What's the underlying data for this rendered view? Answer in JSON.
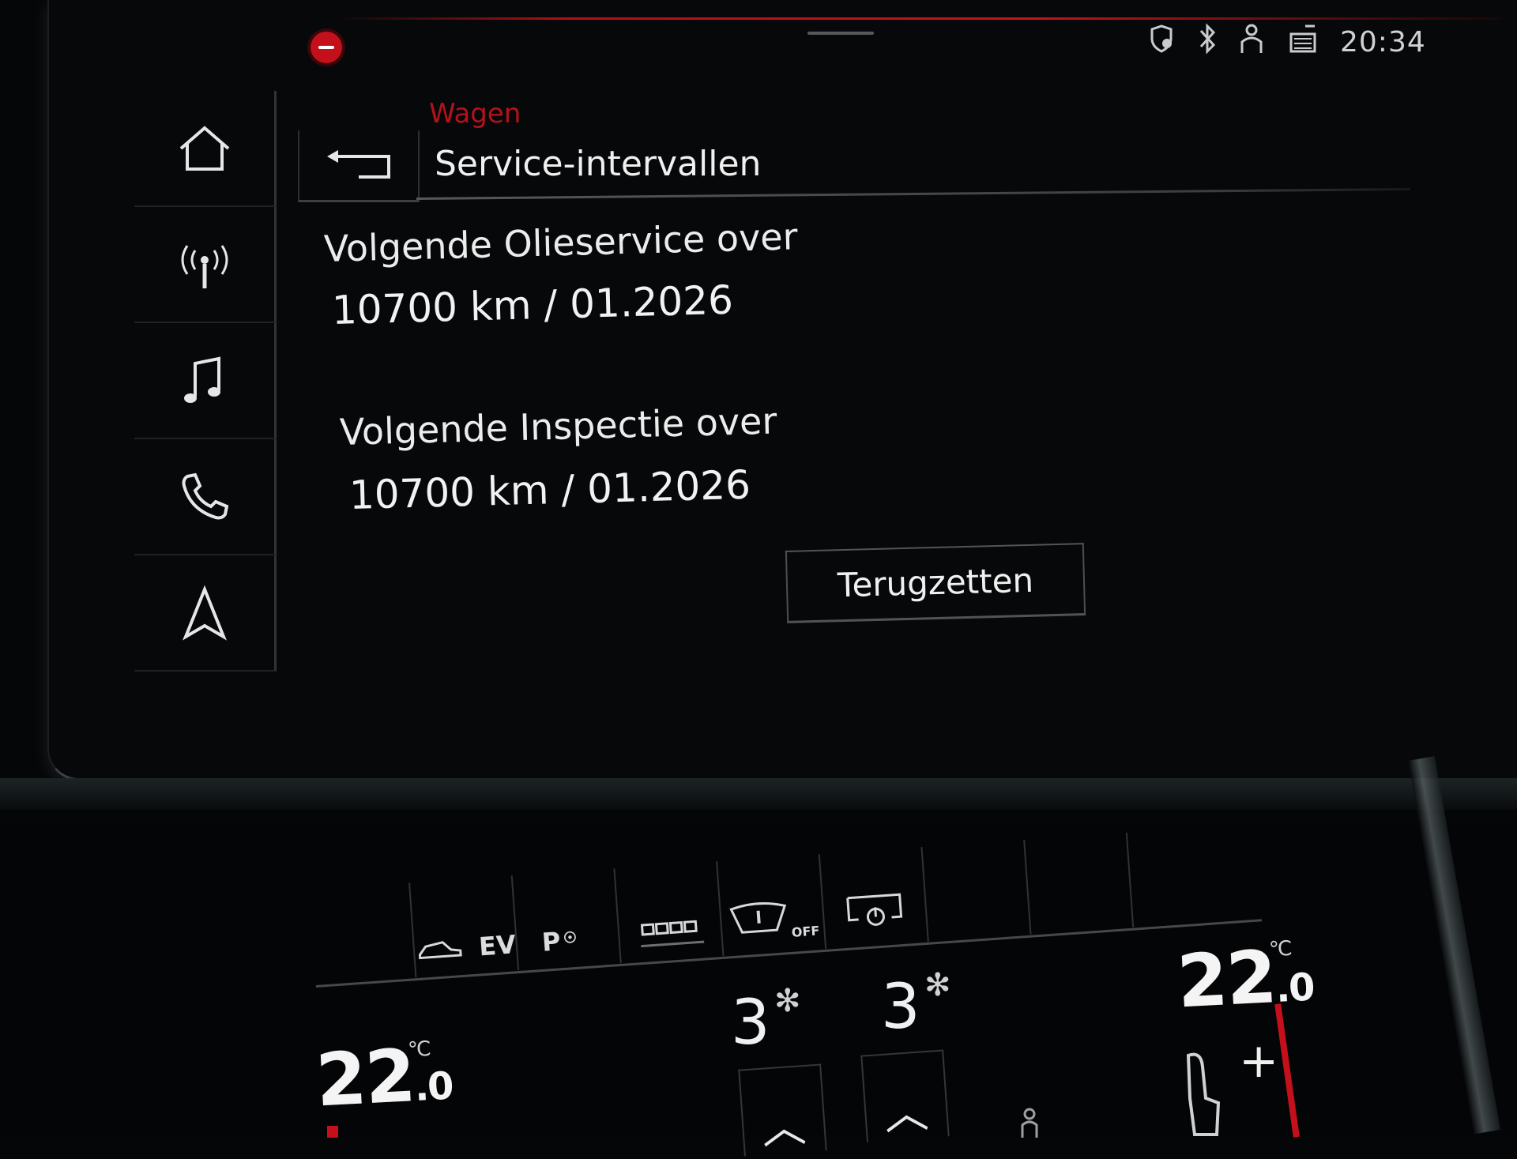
{
  "status_bar": {
    "time": "20:34",
    "icons": [
      "location-shield-icon",
      "bluetooth-icon",
      "driver-profile-icon",
      "data-transfer-icon"
    ]
  },
  "header": {
    "breadcrumb": "Wagen",
    "title": "Service-intervallen"
  },
  "sidebar": {
    "items": [
      {
        "name": "home",
        "icon": "home-icon"
      },
      {
        "name": "radio",
        "icon": "radio-antenna-icon"
      },
      {
        "name": "media",
        "icon": "music-note-icon"
      },
      {
        "name": "phone",
        "icon": "phone-icon"
      },
      {
        "name": "navigation",
        "icon": "navigation-arrow-icon"
      }
    ]
  },
  "service": {
    "oil": {
      "label": "Volgende Olieservice over",
      "value": "10700 km / 01.2026"
    },
    "inspection": {
      "label": "Volgende Inspectie over",
      "value": "10700 km / 01.2026"
    },
    "reset_label": "Terugzetten"
  },
  "climate": {
    "ev_label": "EV",
    "park_label": "P",
    "wiper_off_label": "OFF",
    "left_temp": {
      "int": "22",
      "dec": ".0",
      "unit": "°C"
    },
    "right_temp": {
      "int": "22",
      "dec": ".0",
      "unit": "°C"
    },
    "left_fan": "3",
    "right_fan": "3",
    "plus_label": "+"
  },
  "colors": {
    "accent_red": "#c3101a",
    "breadcrumb_red": "#b3121b",
    "background": "#070809"
  }
}
